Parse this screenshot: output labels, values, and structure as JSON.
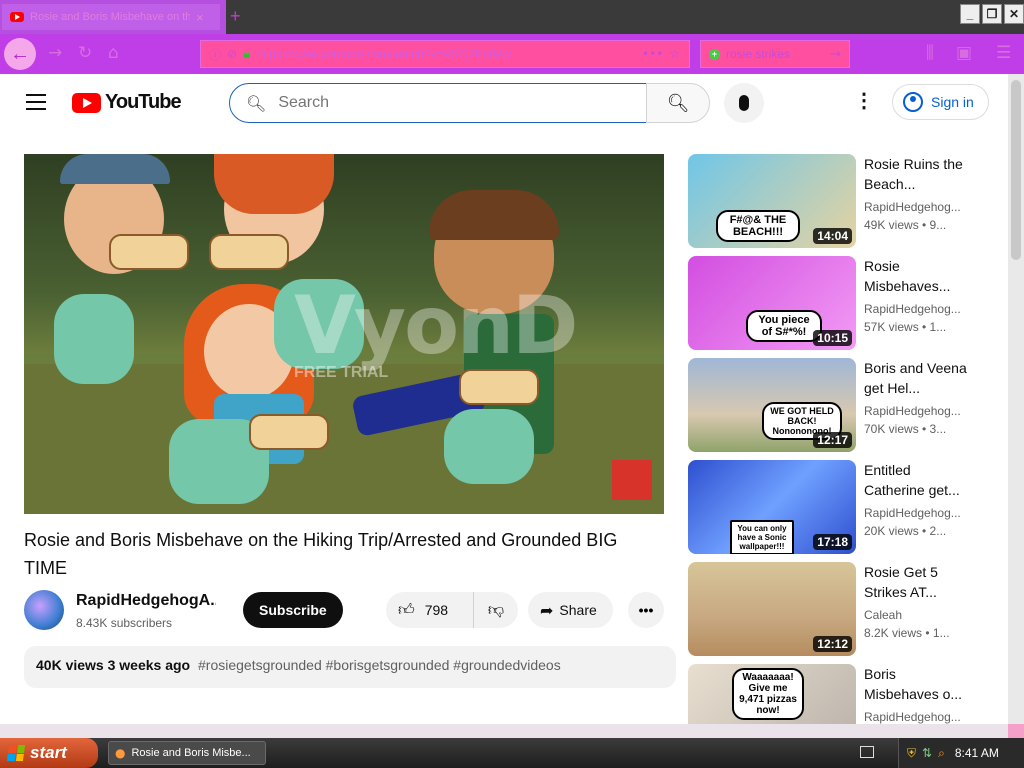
{
  "browser": {
    "tab_title": "Rosie and Boris Misbehave on the Hiking Trip/Arrested",
    "tab_close": "×",
    "new_tab": "+",
    "url": "https://www.youtube.com/watch?v=eSZj7FpfMw",
    "search_query": "rosie strikes",
    "window_buttons": [
      "_",
      "❐",
      "✕"
    ],
    "theme_color": "#bf3ee8"
  },
  "youtube": {
    "logo_text": "YouTube",
    "search_placeholder": "Search",
    "sign_in": "Sign in"
  },
  "video": {
    "title": "Rosie and Boris Misbehave on the Hiking Trip/Arrested and Grounded BIG TIME",
    "watermark": "VyonD",
    "watermark_sub": "FREE TRIAL",
    "channel_name": "RapidHedgehogA...",
    "subscribers": "8.43K subscribers",
    "subscribe_label": "Subscribe",
    "likes": "798",
    "share_label": "Share",
    "views": "40K views",
    "uploaded": "3 weeks ago",
    "tags": "#rosiegetsgrounded #borisgetsgrounded #groundedvideos"
  },
  "recommendations": [
    {
      "title": "Rosie Ruins the Beach...",
      "channel": "RapidHedgehog...",
      "meta": "49K views • 9...",
      "duration": "14:04",
      "thumb_text": "F#@& THE BEACH!!!",
      "thumb_color": "#6fc6e8"
    },
    {
      "title": "Rosie Misbehaves...",
      "channel": "RapidHedgehog...",
      "meta": "57K views • 1...",
      "duration": "10:15",
      "thumb_text": "You piece of S#*%!",
      "thumb_color": "#d24ee0"
    },
    {
      "title": "Boris and Veena get Hel...",
      "channel": "RapidHedgehog...",
      "meta": "70K views • 3...",
      "duration": "12:17",
      "thumb_text": "WE GOT HELD BACK! Nonononono!",
      "thumb_color": "#9fb7d6"
    },
    {
      "title": "Entitled Catherine get...",
      "channel": "RapidHedgehog...",
      "meta": "20K views • 2...",
      "duration": "17:18",
      "thumb_text": "You can only have a Sonic wallpaper!!!",
      "thumb_color": "#2f4fcf"
    },
    {
      "title": "Rosie Get 5 Strikes AT...",
      "channel": "Caleah",
      "meta": "8.2K views • 1...",
      "duration": "12:12",
      "thumb_text": "",
      "thumb_color": "#d8c59a"
    },
    {
      "title": "Boris Misbehaves o...",
      "channel": "RapidHedgehog...",
      "meta": "",
      "duration": "",
      "thumb_text": "Waaaaaaa! Give me 9,471 pizzas now!",
      "thumb_color": "#e8dfd0"
    }
  ],
  "taskbar": {
    "start_label": "start",
    "window_item": "Rosie and Boris Misbe...",
    "clock": "8:41 AM"
  }
}
